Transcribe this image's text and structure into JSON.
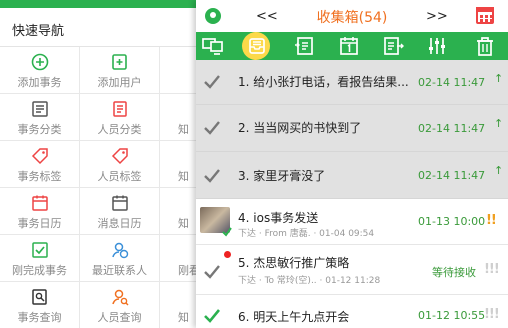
{
  "nav": {
    "title": "快速导航",
    "rows": [
      [
        "添加事务",
        "添加用户",
        ""
      ],
      [
        "事务分类",
        "人员分类",
        "知"
      ],
      [
        "事务标签",
        "人员标签",
        "知"
      ],
      [
        "事务日历",
        "消息日历",
        "知"
      ],
      [
        "刚完成事务",
        "最近联系人",
        "刚看"
      ],
      [
        "事务查询",
        "人员查询",
        "知"
      ]
    ],
    "accent": "#2bb14f"
  },
  "header": {
    "prev_label": "<<",
    "next_label": ">>",
    "title": "收集箱(54)",
    "title_color": "#f07020"
  },
  "toolbar": {
    "icons": [
      "monitor-icon",
      "inbox-icon",
      "download-list-icon",
      "calendar-day-icon",
      "export-list-icon",
      "sliders-icon",
      "trash-icon"
    ],
    "active": "inbox-icon"
  },
  "items": [
    {
      "title": "1. 给小张打电话，看报告结果...",
      "time": "02-14 11:47",
      "mark": "↑",
      "done": false
    },
    {
      "title": "2. 当当网买的书快到了",
      "time": "02-14 11:47",
      "mark": "↑",
      "done": false
    },
    {
      "title": "3. 家里牙膏没了",
      "time": "02-14 11:47",
      "mark": "↑",
      "done": false
    },
    {
      "title": "4. ios事务发送",
      "sub": "下达 · From 唐磊. · 01-04 09:54",
      "time": "01-13 10:00",
      "prio": "!!",
      "prio_color": "#f0a020"
    },
    {
      "title": "5. 杰思敏行推广策略",
      "sub": "下达 · To 常玲(空).. · 01-12 11:28",
      "time": "等待接收",
      "prio": "!!!",
      "prio_color": "#cfcfcf"
    },
    {
      "title": "6. 明天上午九点开会",
      "time": "01-12 10:55",
      "prio": "!!!",
      "prio_color": "#cfcfcf"
    }
  ]
}
